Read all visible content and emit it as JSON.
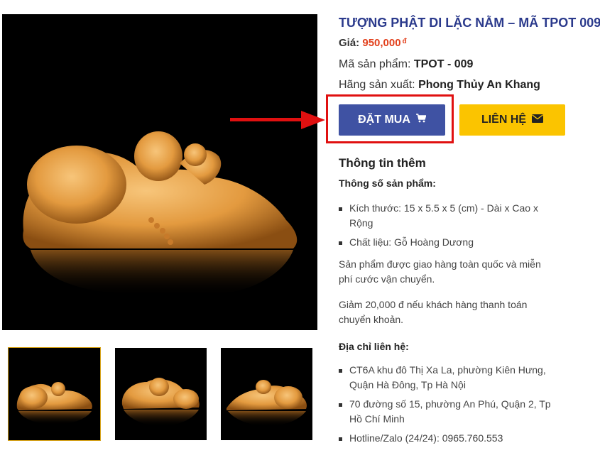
{
  "product": {
    "title": "TƯỢNG PHẬT DI LẶC NẰM – MÃ TPOT 009",
    "price_label": "Giá:",
    "price_value": "950,000",
    "currency": "đ",
    "sku_label": "Mã sản phẩm:",
    "sku_value": "TPOT - 009",
    "maker_label": "Hãng sản xuất:",
    "maker_value": "Phong Thủy An Khang"
  },
  "actions": {
    "buy_label": "ĐẶT MUA",
    "buy_icon": "cart-icon",
    "contact_label": "LIÊN HỆ",
    "contact_icon": "envelope-icon"
  },
  "details": {
    "section_title": "Thông tin thêm",
    "specs_title": "Thông số sản phẩm:",
    "specs": [
      "Kích thước: 15 x 5.5 x 5 (cm) - Dài x Cao x Rộng",
      "Chất liệu: Gỗ Hoàng Dương"
    ],
    "shipping_note": "Sản phẩm được giao hàng toàn quốc và miễn phí cước vận chuyển.",
    "discount_note": "Giảm 20,000 đ nếu khách hàng thanh toán chuyển khoản.",
    "contact_title": "Địa chỉ liên hệ:",
    "contacts": [
      "CT6A khu đô Thị Xa La, phường Kiên Hưng, Quận Hà Đông, Tp Hà Nội",
      "70 đường số 15, phường An Phú, Quận 2, Tp Hồ Chí Minh",
      "Hotline/Zalo (24/24): 0965.760.553"
    ]
  },
  "colors": {
    "title": "#2b3a8c",
    "price": "#e2401c",
    "buy_button": "#3f52a3",
    "contact_button": "#fbc400",
    "annotation": "#e01010"
  },
  "gallery": {
    "thumbnail_count": 3,
    "active_thumbnail": 0
  }
}
